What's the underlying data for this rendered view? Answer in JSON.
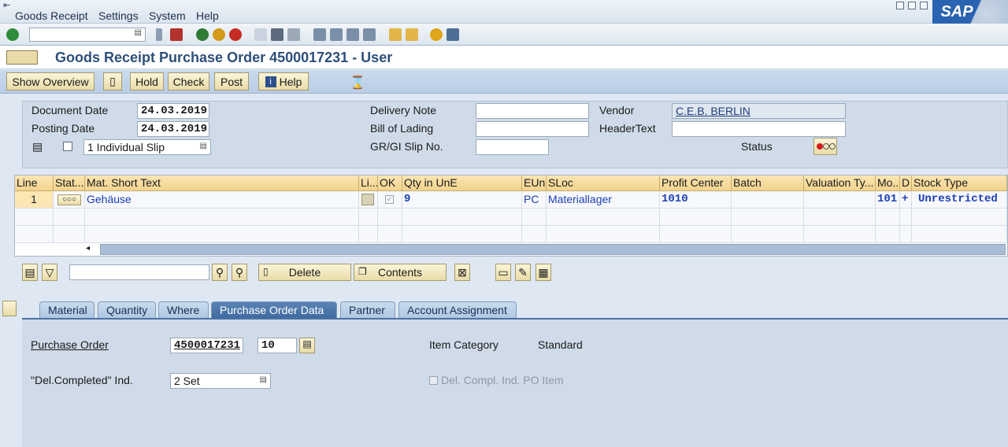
{
  "menu": [
    "Goods Receipt",
    "Settings",
    "System",
    "Help"
  ],
  "logo": "SAP",
  "title": "Goods Receipt Purchase Order 4500017231 - User",
  "app_toolbar": {
    "show_overview": "Show Overview",
    "hold": "Hold",
    "check": "Check",
    "post": "Post",
    "help": "Help"
  },
  "header": {
    "document_date_label": "Document Date",
    "document_date": "24.03.2019",
    "posting_date_label": "Posting Date",
    "posting_date": "24.03.2019",
    "slip_option": "1 Individual Slip",
    "delivery_note_label": "Delivery Note",
    "delivery_note": "",
    "bill_of_lading_label": "Bill of Lading",
    "bill_of_lading": "",
    "gr_gi_slip_label": "GR/GI Slip No.",
    "gr_gi_slip": "",
    "vendor_label": "Vendor",
    "vendor": "C.E.B. BERLIN",
    "header_text_label": "HeaderText",
    "header_text": "",
    "status_label": "Status"
  },
  "grid": {
    "columns": [
      "Line",
      "Stat...",
      "Mat. Short Text",
      "Li...",
      "OK",
      "Qty in UnE",
      "EUn",
      "SLoc",
      "Profit Center",
      "Batch",
      "Valuation Ty...",
      "Mo...",
      "D",
      "Stock Type"
    ],
    "rows": [
      {
        "line": "1",
        "text": "Gehäuse",
        "qty": "9",
        "eun": "PC",
        "sloc": "Materiallager",
        "profit_center": "1010",
        "mvmt": "101",
        "d": "+",
        "stock_type": "Unrestricted"
      }
    ]
  },
  "item_toolbar": {
    "delete": "Delete",
    "contents": "Contents"
  },
  "tabs": [
    "Material",
    "Quantity",
    "Where",
    "Purchase Order Data",
    "Partner",
    "Account Assignment"
  ],
  "po_data": {
    "purchase_order_label": "Purchase Order",
    "purchase_order": "4500017231",
    "item": "10",
    "item_category_label": "Item Category",
    "item_category": "Standard",
    "del_completed_label": "\"Del.Completed\" Ind.",
    "del_completed": "2 Set",
    "del_compl_po_item": "Del. Compl. Ind. PO Item"
  }
}
